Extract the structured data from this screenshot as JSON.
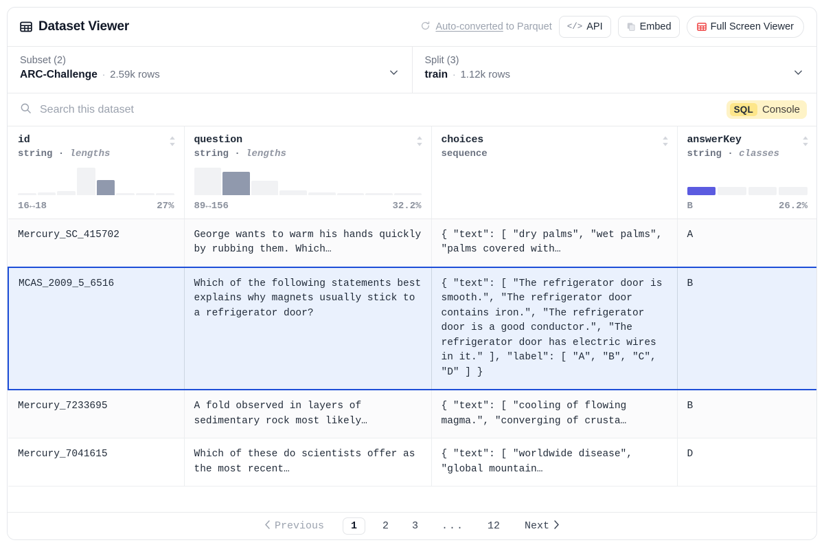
{
  "header": {
    "title": "Dataset Viewer",
    "grid_icon": "table-grid-icon",
    "autoconverted": {
      "refresh_icon": "refresh-icon",
      "link_text": "Auto-converted",
      "suffix_text": " to Parquet"
    },
    "buttons": [
      {
        "name": "api-button",
        "icon": "code-brackets-icon",
        "icon_glyph": "</>",
        "label": "API"
      },
      {
        "name": "embed-button",
        "icon": "copy-icon",
        "label": "Embed"
      },
      {
        "name": "full-screen-viewer-button",
        "icon": "table-grid-icon",
        "label": "Full Screen Viewer"
      }
    ]
  },
  "selectors": [
    {
      "name": "subset-selector",
      "label": "Subset (2)",
      "value": "ARC-Challenge",
      "separator": "·",
      "rows": "2.59k rows",
      "chevron": "chevron-down-icon"
    },
    {
      "name": "split-selector",
      "label": "Split (3)",
      "value": "train",
      "separator": "·",
      "rows": "1.12k rows",
      "chevron": "chevron-down-icon"
    }
  ],
  "search": {
    "icon": "search-icon",
    "placeholder": "Search this dataset",
    "value": "",
    "sql_badge": "SQL",
    "sql_label": "Console"
  },
  "table": {
    "columns": [
      {
        "name": "id",
        "type_prefix": "string",
        "type_sep": "·",
        "type_suffix": "lengths",
        "stat_kind": "histogram",
        "range_label": "16↔18",
        "pct_label": "27%",
        "bars": [
          6,
          9,
          16,
          100,
          54,
          8,
          7,
          7
        ],
        "highlight_index": 4
      },
      {
        "name": "question",
        "type_prefix": "string",
        "type_sep": "·",
        "type_suffix": "lengths",
        "stat_kind": "histogram",
        "range_label": "89↔156",
        "pct_label": "32.2%",
        "bars": [
          100,
          84,
          53,
          18,
          9,
          8,
          8,
          8
        ],
        "highlight_index": 1
      },
      {
        "name": "choices",
        "type_prefix": "sequence",
        "type_sep": "",
        "type_suffix": "",
        "stat_kind": "none",
        "range_label": "",
        "pct_label": "",
        "bars": [],
        "highlight_index": -1
      },
      {
        "name": "answerKey",
        "type_prefix": "string",
        "type_sep": "·",
        "type_suffix": "classes",
        "stat_kind": "classes",
        "range_label": "B",
        "pct_label": "26.2%",
        "segments": [
          1,
          0,
          0,
          0
        ],
        "accent_color": "#5b5be0"
      }
    ],
    "rows": [
      {
        "selected": false,
        "id": "Mercury_SC_415702",
        "question": "George wants to warm his hands quickly by rubbing them. Which…",
        "choices": "{ \"text\": [ \"dry palms\", \"wet palms\", \"palms covered with…",
        "answerKey": "A"
      },
      {
        "selected": true,
        "id": "MCAS_2009_5_6516",
        "question": "Which of the following statements best explains why magnets usually stick to a refrigerator door?",
        "choices": "{ \"text\": [ \"The refrigerator door is smooth.\", \"The refrigerator door contains iron.\", \"The refrigerator door is a good conductor.\", \"The refrigerator door has electric wires in it.\" ], \"label\": [ \"A\", \"B\", \"C\", \"D\" ] }",
        "answerKey": "B"
      },
      {
        "selected": false,
        "id": "Mercury_7233695",
        "question": "A fold observed in layers of sedimentary rock most likely…",
        "choices": "{ \"text\": [ \"cooling of flowing magma.\", \"converging of crusta…",
        "answerKey": "B"
      },
      {
        "selected": false,
        "id": "Mercury_7041615",
        "question": "Which of these do scientists offer as the most recent…",
        "choices": "{ \"text\": [ \"worldwide disease\", \"global mountain…",
        "answerKey": "D"
      }
    ]
  },
  "pagination": {
    "previous_label": "Previous",
    "previous_icon": "chevron-left-icon",
    "next_label": "Next",
    "next_icon": "chevron-right-icon",
    "pages": [
      "1",
      "2",
      "3",
      "...",
      "12"
    ],
    "current_page": "1"
  },
  "colors": {
    "selected_row_border": "#1d4ed8",
    "selected_row_bg": "#eaf1fd",
    "accent_indigo": "#5b5be0",
    "sql_badge_bg": "#fde68a",
    "sql_button_bg": "#fef3c7",
    "histogram_bar": "#f1f2f4",
    "histogram_bar_highlight": "#9099ad"
  }
}
